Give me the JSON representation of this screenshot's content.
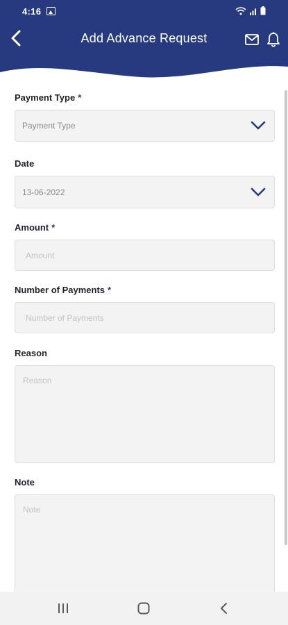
{
  "status_bar": {
    "time": "4:16"
  },
  "header": {
    "title": "Add Advance Request",
    "back_icon": "chevron-left-icon",
    "mail_icon": "mail-icon",
    "bell_icon": "bell-icon",
    "color": "#273a7f"
  },
  "form": {
    "payment_type": {
      "label": "Payment Type",
      "required": "*",
      "placeholder": "Payment Type"
    },
    "date": {
      "label": "Date",
      "value": "13-06-2022"
    },
    "amount": {
      "label": "Amount",
      "required": "*",
      "placeholder": "Amount"
    },
    "num_payments": {
      "label": "Number of Payments",
      "required": "*",
      "placeholder": "Number of Payments"
    },
    "reason": {
      "label": "Reason",
      "placeholder": "Reason"
    },
    "note": {
      "label": "Note",
      "placeholder": "Note"
    }
  },
  "nav": {
    "recents_icon": "recents-icon",
    "home_icon": "home-icon",
    "back_icon": "back-icon"
  }
}
